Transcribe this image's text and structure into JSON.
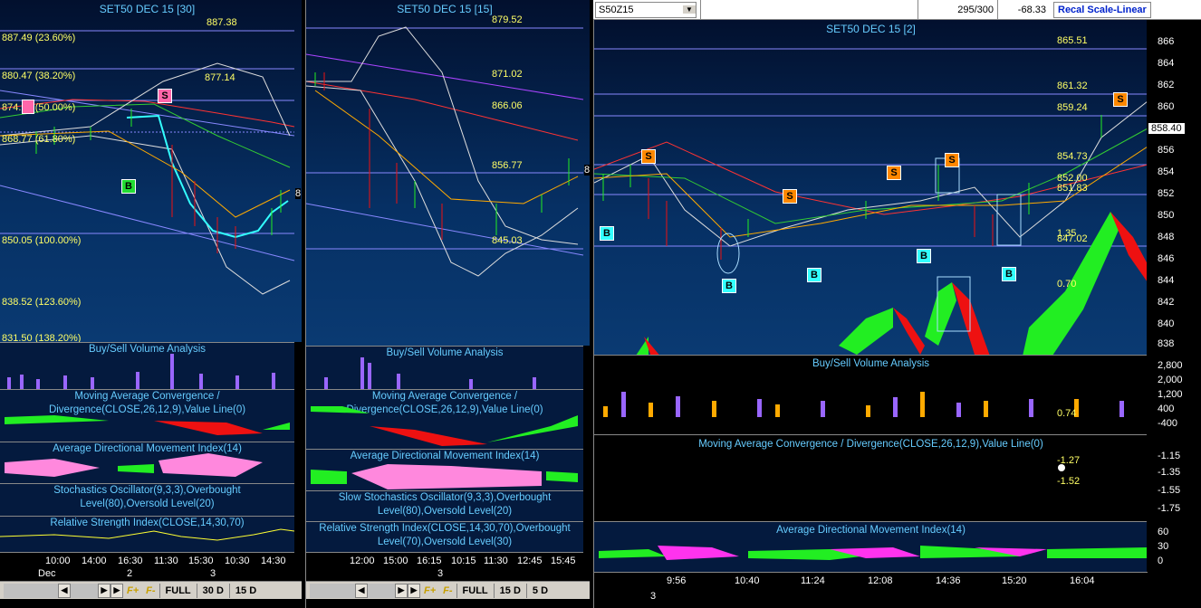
{
  "left": {
    "title": "SET50 DEC 15  [30]",
    "price_levels": [
      "887.38",
      "887.49 (23.60%)",
      "880.47 (38.20%)",
      "877.14",
      "874.62 (50.00%)",
      "868.77 (61.80%)",
      "850.05 (100.00%)",
      "838.52 (123.60%)",
      "831.50 (138.20%)"
    ],
    "right_label": "8",
    "signals": [
      "S",
      "B"
    ],
    "sub_titles": [
      "Buy/Sell Volume Analysis",
      "Moving Average Convergence / Divergence(CLOSE,26,12,9),Value Line(0)",
      "Average Directional Movement Index(14)",
      "Stochastics Oscillator(9,3,3),Overbought Level(80),Oversold Level(20)",
      "Relative Strength Index(CLOSE,14,30,70)"
    ],
    "times": [
      "10:00",
      "14:00",
      "16:30",
      "11:30",
      "15:30",
      "10:30",
      "14:30"
    ],
    "dates": [
      "Dec",
      "2",
      "3"
    ],
    "buttons": [
      "FULL",
      "30 D",
      "15 D"
    ],
    "fbtns": [
      "F+",
      "F-"
    ]
  },
  "middle": {
    "title": "SET50 DEC 15  [15]",
    "price_levels": [
      "879.52",
      "871.02",
      "866.06",
      "856.77",
      "845.03"
    ],
    "right_label": "8",
    "sub_titles": [
      "Buy/Sell Volume Analysis",
      "Moving Average Convergence / Divergence(CLOSE,26,12,9),Value Line(0)",
      "Average Directional Movement Index(14)",
      "Slow Stochastics Oscillator(9,3,3),Overbought Level(80),Oversold Level(20)",
      "Relative Strength Index(CLOSE,14,30,70),Overbought Level(70),Oversold Level(30)"
    ],
    "times": [
      "12:00",
      "15:00",
      "16:15",
      "10:15",
      "11:30",
      "12:45",
      "15:45"
    ],
    "dates": [
      "3"
    ],
    "buttons": [
      "FULL",
      "15 D",
      "5 D"
    ],
    "fbtns": [
      "F+",
      "F-"
    ]
  },
  "right": {
    "symbol": "S50Z15",
    "count": "295/300",
    "change": "-68.33",
    "recal": "Recal Scale-Linear",
    "title": "SET50 DEC 15  [2]",
    "price_levels": [
      "865.51",
      "861.32",
      "859.24",
      "854.73",
      "852.00",
      "851.83",
      "847.02",
      "1.35",
      "0.70",
      "0.74"
    ],
    "current_price": "858.40",
    "axis": [
      "866",
      "864",
      "862",
      "860",
      "858",
      "856",
      "854",
      "852",
      "850",
      "848",
      "846",
      "844",
      "842",
      "840",
      "838"
    ],
    "vol_axis": [
      "2,800",
      "2,000",
      "1,200",
      "400",
      "-400"
    ],
    "macd_axis": [
      "-1.15",
      "-1.35",
      "-1.55",
      "-1.75"
    ],
    "macd_vals": [
      "-1.27",
      "-1.52"
    ],
    "adx_axis": [
      "60",
      "30",
      "0"
    ],
    "sub_titles": [
      "Buy/Sell Volume Analysis",
      "Moving Average Convergence / Divergence(CLOSE,26,12,9),Value Line(0)",
      "Average Directional Movement Index(14)"
    ],
    "times": [
      "9:56",
      "10:40",
      "11:24",
      "12:08",
      "14:36",
      "15:20",
      "16:04"
    ],
    "dates": [
      "3"
    ],
    "signals_b": [
      "B",
      "B",
      "B",
      "B",
      "B"
    ],
    "signals_s": [
      "S",
      "S",
      "S",
      "S",
      "S"
    ]
  },
  "colors": {
    "green": "#22ee22",
    "red": "#ee1111",
    "cyan": "#33ffff",
    "yellow": "#ffff66"
  }
}
